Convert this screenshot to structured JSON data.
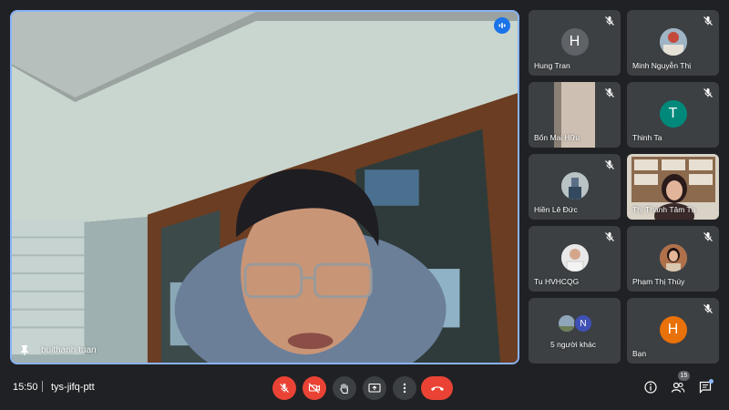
{
  "main": {
    "speaker_name": "buithanh tuan"
  },
  "tiles": [
    {
      "name": "Hung Tran",
      "initial": "H",
      "color": "#5f6368",
      "kind": "letter"
    },
    {
      "name": "Minh Nguyễn Thị",
      "initial": "",
      "color": "#8a9aa8",
      "kind": "photo"
    },
    {
      "name": "Bốn Mai Hữu",
      "initial": "",
      "color": "#c8bfb5",
      "kind": "video"
    },
    {
      "name": "Thinh Ta",
      "initial": "T",
      "color": "#00897b",
      "kind": "letter"
    },
    {
      "name": "Hiền Lê Đức",
      "initial": "",
      "color": "#8a9aa8",
      "kind": "photo"
    },
    {
      "name": "Thị Thanh Tâm Tạ",
      "initial": "",
      "color": "#d7d0c4",
      "kind": "video"
    },
    {
      "name": "Tu HVHCQG",
      "initial": "",
      "color": "#e0e0e0",
      "kind": "photo"
    },
    {
      "name": "Phạm Thị Thúy",
      "initial": "",
      "color": "#b0704a",
      "kind": "photo"
    },
    {
      "name": "5 người khác",
      "initial": "N",
      "color": "#3f51b5",
      "kind": "others"
    },
    {
      "name": "Bạn",
      "initial": "H",
      "color": "#e8710a",
      "kind": "letter"
    }
  ],
  "bottombar": {
    "time": "15:50",
    "meeting_code": "tys-jifq-ptt",
    "participants_count": "15"
  },
  "colors": {
    "accent": "#8ab4f8",
    "danger": "#ea4335",
    "tile_bg": "#3c4043"
  }
}
